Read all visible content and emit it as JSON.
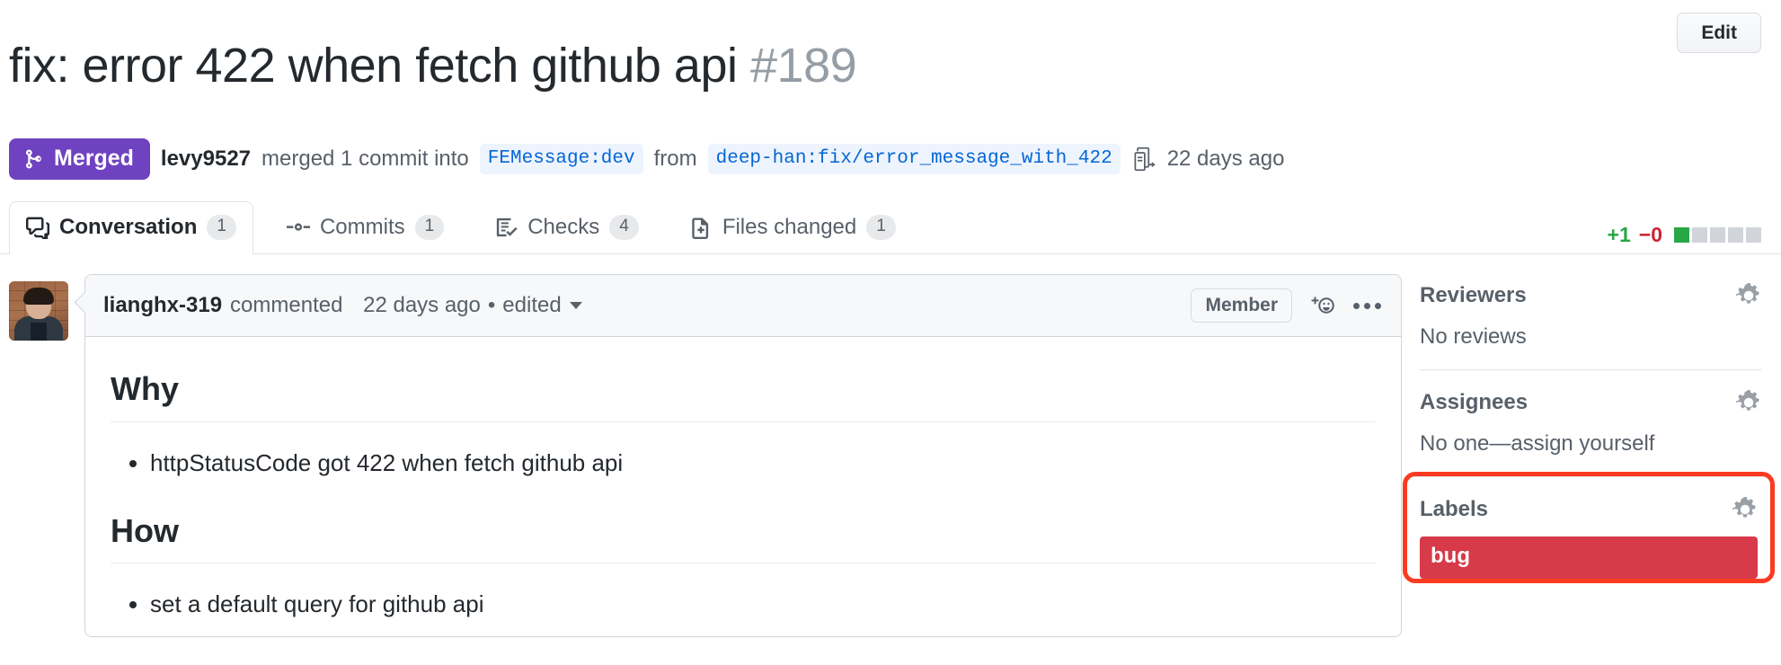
{
  "header": {
    "title": "fix: error 422 when fetch github api",
    "number": "#189",
    "edit_label": "Edit"
  },
  "meta": {
    "state": "Merged",
    "author": "levy9527",
    "merged_text": "merged 1 commit into",
    "base_branch": "FEMessage:dev",
    "from_text": "from",
    "head_branch": "deep-han:fix/error_message_with_422",
    "time": "22 days ago"
  },
  "tabs": [
    {
      "label": "Conversation",
      "count": "1",
      "icon": "comment-discussion-icon",
      "selected": true
    },
    {
      "label": "Commits",
      "count": "1",
      "icon": "git-commit-icon",
      "selected": false
    },
    {
      "label": "Checks",
      "count": "4",
      "icon": "checklist-icon",
      "selected": false
    },
    {
      "label": "Files changed",
      "count": "1",
      "icon": "file-diff-icon",
      "selected": false
    }
  ],
  "diffstat": {
    "additions": "+1",
    "deletions": "−0",
    "blocks_total": 5,
    "blocks_added": 1,
    "add_color": "#28a745",
    "del_color": "#cb2431"
  },
  "comment": {
    "author": "lianghx-319",
    "action": "commented",
    "time": "22 days ago",
    "separator": "•",
    "edited": "edited",
    "association": "Member",
    "sections": [
      {
        "heading": "Why",
        "items": [
          "httpStatusCode got 422 when fetch github api"
        ]
      },
      {
        "heading": "How",
        "items": [
          "set a default query for github api"
        ]
      }
    ]
  },
  "sidebar": {
    "reviewers": {
      "title": "Reviewers",
      "empty": "No reviews"
    },
    "assignees": {
      "title": "Assignees",
      "empty": "No one—assign yourself"
    },
    "labels": {
      "title": "Labels",
      "items": [
        {
          "name": "bug",
          "color": "#d73a49"
        }
      ],
      "highlight_color": "#fa3b22"
    }
  }
}
